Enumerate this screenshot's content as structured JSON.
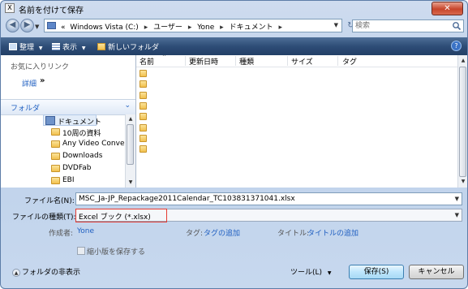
{
  "window": {
    "title": "名前を付けて保存",
    "close_glyph": "✕"
  },
  "address": {
    "chevron": "«",
    "segments": [
      "Windows Vista (C:)",
      "ユーザー",
      "Yone",
      "ドキュメント"
    ],
    "separator": "▸"
  },
  "search": {
    "placeholder": "検索"
  },
  "toolbar": {
    "organize": "整理",
    "views": "表示",
    "new_folder": "新しいフォルダ",
    "dropdown_glyph": "▼",
    "help": "?"
  },
  "sidebar": {
    "favorites_title": "お気に入りリンク",
    "details_link": "詳細",
    "details_arrow": "»",
    "folders_label": "フォルダ",
    "folders_chevron": "⌄",
    "tree": [
      "ドキュメント",
      "10周の資料",
      "Any Video Convert",
      "Downloads",
      "DVDFab",
      "EBI"
    ]
  },
  "filelist": {
    "columns": [
      "名前",
      "更新日時",
      "種類",
      "サイズ",
      "タグ"
    ],
    "sort_glyph": "^",
    "row_count": 8,
    "edge_glyphs": [
      "P",
      "P",
      "P",
      "c",
      "E",
      "t",
      "t",
      "t"
    ]
  },
  "form": {
    "filename_label": "ファイル名(N):",
    "filename_value": "MSC_Ja-JP_Repackage2011Calendar_TC103831371041.xlsx",
    "filetype_label": "ファイルの種類(T):",
    "filetype_value": "Excel ブック (*.xlsx)",
    "author_label": "作成者:",
    "author_value": "Yone",
    "tags_label": "タグ:",
    "tags_value": "タグの追加",
    "title_label": "タイトル:",
    "title_value": "タイトルの追加",
    "thumbnail_label": "縮小版を保存する"
  },
  "footer": {
    "hide_folders": "フォルダの非表示",
    "hide_glyph": "▲",
    "tools": "ツール(L)",
    "save": "保存(S)",
    "cancel": "キャンセル"
  },
  "colors": {
    "highlight_box": "#e53b32",
    "link": "#1f5fc1",
    "toolbar": "#2e4d77"
  }
}
